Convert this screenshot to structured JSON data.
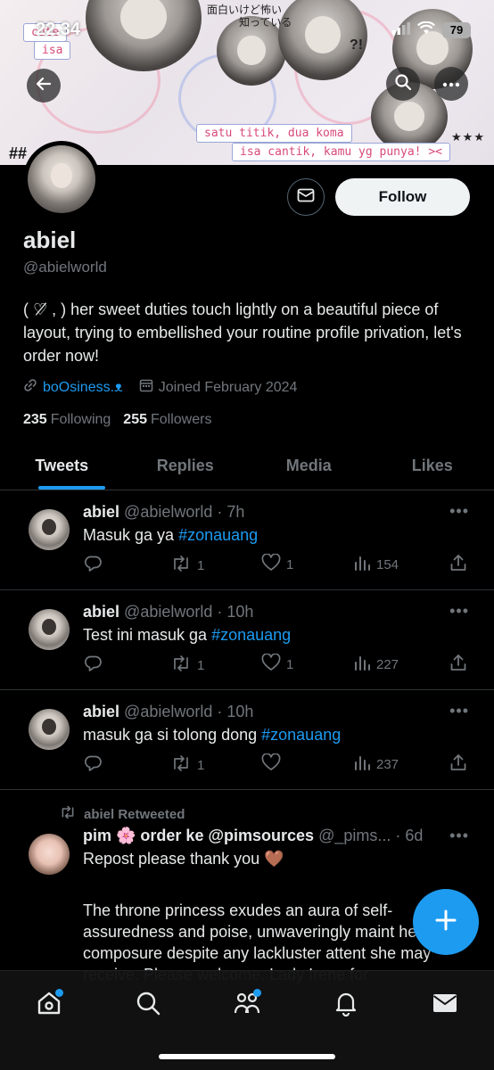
{
  "status_bar": {
    "time": "22.34",
    "battery": "79"
  },
  "banner": {
    "stickers": [
      "cute",
      "isa",
      "satu titik, dua koma",
      "isa cantik, kamu yg punya! ><"
    ],
    "japanese_line1": "面白いけど怖い",
    "japanese_line2": "知っている",
    "qmark": "?!",
    "stars": "★★★",
    "hash": "##"
  },
  "profile": {
    "display_name": "abiel",
    "handle": "@abielworld",
    "bio": "( ♡̸ , ) her sweet duties touch lightly on a beautiful piece of layout, trying to embellished your routine profile privation, let's order now!",
    "link": "boOsiness.ᴥ",
    "joined": "Joined February 2024",
    "following_count": "235",
    "following_label": "Following",
    "followers_count": "255",
    "followers_label": "Followers",
    "follow_label": "Follow"
  },
  "tabs": [
    "Tweets",
    "Replies",
    "Media",
    "Likes"
  ],
  "tweets": [
    {
      "name": "abiel",
      "meta": "@abielworld · 7h",
      "text": "Masuk ga ya ",
      "hashtag": "#zonauang",
      "retweets": "1",
      "likes": "1",
      "views": "154"
    },
    {
      "name": "abiel",
      "meta": "@abielworld · 10h",
      "text": "Test ini masuk ga ",
      "hashtag": "#zonauang",
      "retweets": "1",
      "likes": "1",
      "views": "227"
    },
    {
      "name": "abiel",
      "meta": "@abielworld · 10h",
      "text": "masuk ga si tolong dong ",
      "hashtag": "#zonauang",
      "retweets": "1",
      "likes": "",
      "views": "237"
    }
  ],
  "retweet": {
    "label": "abiel Retweeted",
    "name": "pim 🌸 order ke @pimsources",
    "meta": "@_pims... · 6d",
    "line1": "Repost please thank you 🤎",
    "body": "The throne princess exudes an aura of self-assuredness and poise, unwaveringly maint her composure despite any lackluster attent she may receive. Please welcome, Lady Irene for"
  }
}
